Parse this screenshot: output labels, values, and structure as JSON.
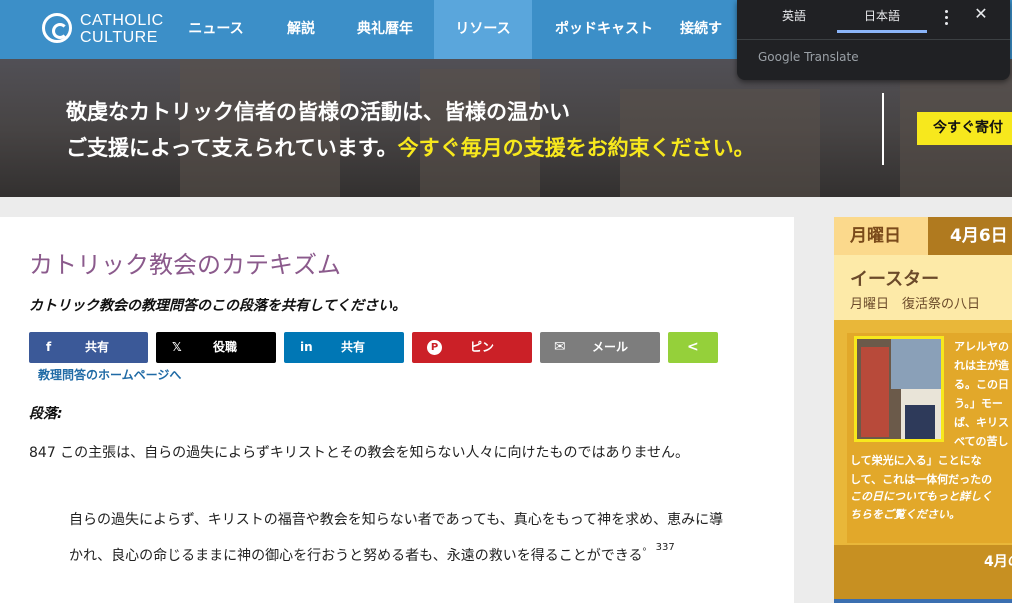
{
  "logo": {
    "line1": "CATHOLIC",
    "line2": "CULTURE"
  },
  "nav": {
    "items": [
      {
        "label": "ニュース",
        "active": false
      },
      {
        "label": "解説",
        "active": false
      },
      {
        "label": "典礼暦年",
        "active": false
      },
      {
        "label": "リソース",
        "active": true
      },
      {
        "label": "ポッドキャスト",
        "active": false
      },
      {
        "label": "接続す",
        "active": false
      }
    ]
  },
  "hero": {
    "line1": "敬虔なカトリック信者の皆様の活動は、皆様の温かい",
    "line2_plain": "ご支援によって支えられています。",
    "line2_highlight": "今すぐ毎月の支援をお約束ください。",
    "donate_label": "今すぐ寄付"
  },
  "translate": {
    "tab_source": "英語",
    "tab_target": "日本語",
    "brand": "Google Translate",
    "close_glyph": "✕"
  },
  "main": {
    "title": "カトリック教会のカテキズム",
    "share_prompt": "カトリック教会の教理問答のこの段落を共有してください。",
    "share_buttons": [
      {
        "network": "facebook",
        "icon": "f",
        "label": "共有",
        "color": "#3b5998"
      },
      {
        "network": "x",
        "icon": "𝕏",
        "label": "役職",
        "color": "#000000"
      },
      {
        "network": "linkedin",
        "icon": "in",
        "label": "共有",
        "color": "#0077b5"
      },
      {
        "network": "pinterest",
        "icon": "P",
        "label": "ピン",
        "color": "#cb2027"
      },
      {
        "network": "email",
        "icon": "✉",
        "label": "メール",
        "color": "#7d7d7d"
      },
      {
        "network": "share",
        "icon": "<",
        "label": "",
        "color": "#95d03a"
      }
    ],
    "home_link": "教理問答のホームページへ",
    "paragraph_label": "段落:",
    "paragraph_text": "847 この主張は、自らの過失によらずキリストとその教会を知らない人々に向けたものではありません。",
    "quote_text": "自らの過失によらず、キリストの福音や教会を知らない者であっても、真心をもって神を求め、恵みに導かれ、良心の命じるままに神の御心を行おうと努める者も、永遠の救いを得ることができる",
    "quote_end": "。",
    "footnote": "337"
  },
  "sidebar": {
    "day": "月曜日",
    "date": "4月6日",
    "feast": "イースター",
    "subtitle": "月曜日　復活祭の八日",
    "text_lines": [
      "アレルヤの",
      "れは主が造",
      "る。この日",
      "う。」モー",
      "ば、キリス",
      "べての苦し"
    ],
    "full_lines": [
      "して栄光に入る」ことにな",
      "して、これは一体何だったの"
    ],
    "more_lines": [
      "この日についてもっと詳しく",
      "ちらをご覧ください。"
    ],
    "footer": "4月の"
  }
}
